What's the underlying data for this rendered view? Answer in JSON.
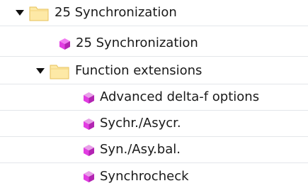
{
  "tree": {
    "root": {
      "label": "25 Synchronization",
      "expanded": true,
      "icon": "folder-icon"
    },
    "root_block": {
      "label": "25 Synchronization",
      "icon": "function-block-icon"
    },
    "group": {
      "label": "Function extensions",
      "expanded": true,
      "icon": "folder-icon"
    },
    "children": [
      {
        "label": "Advanced delta-f options",
        "icon": "function-block-icon"
      },
      {
        "label": "Sychr./Asycr.",
        "icon": "function-block-icon"
      },
      {
        "label": "Syn./Asy.bal.",
        "icon": "function-block-icon"
      },
      {
        "label": "Synchrocheck",
        "icon": "function-block-icon"
      }
    ]
  },
  "colors": {
    "folder_light": "#fde9a6",
    "folder_dark": "#e6c15a",
    "block_magenta": "#e23de2",
    "block_dark": "#b224b2",
    "row_divider": "#e3e6ea",
    "arrow": "#111111"
  }
}
